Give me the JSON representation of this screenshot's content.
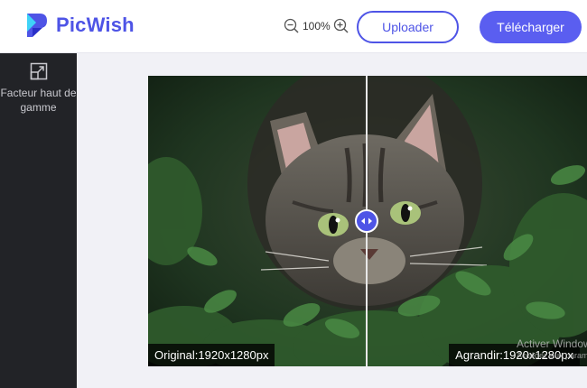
{
  "app": {
    "name": "PicWish",
    "brand_color": "#4e54e6"
  },
  "header": {
    "zoom_value": "100%",
    "upload_label": "Uploader",
    "download_label": "Télécharger",
    "download_color": "#5a5ef0"
  },
  "sidebar": {
    "items": [
      {
        "label": "Facteur haut de gamme",
        "icon": "resize-icon"
      }
    ]
  },
  "preview": {
    "original_label": "Original:1920x1280px",
    "enlarged_label": "Agrandir:1920x1280px"
  },
  "watermark": {
    "line1": "Activer Windows",
    "line2": "Accédez aux paramètres"
  }
}
